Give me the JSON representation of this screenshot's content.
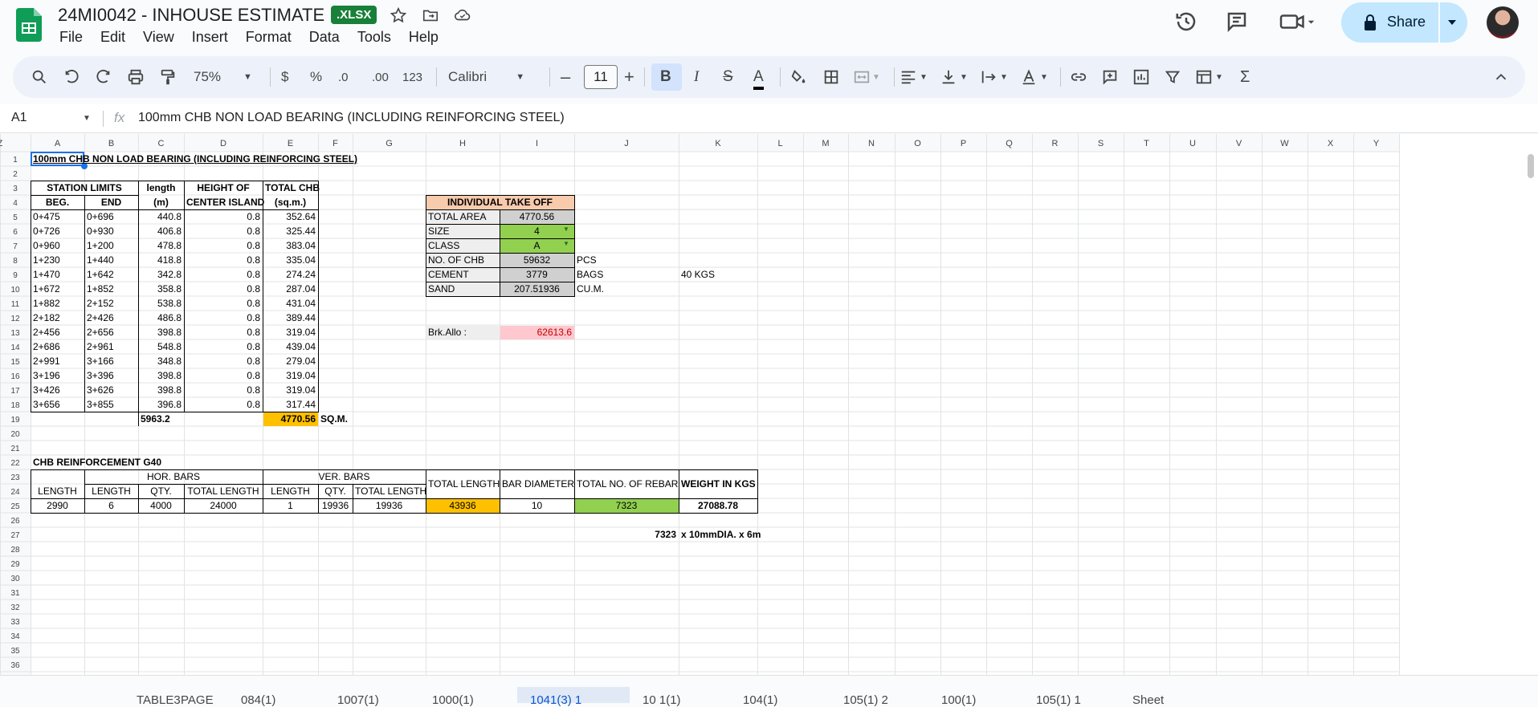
{
  "app": {
    "title": "24MI0042 - INHOUSE ESTIMATE",
    "badge": ".XLSX",
    "share_label": "Share",
    "menu": [
      "File",
      "Edit",
      "View",
      "Insert",
      "Format",
      "Data",
      "Tools",
      "Help"
    ]
  },
  "toolbar": {
    "zoom": "75%",
    "currency": "$",
    "percent": "%",
    "dec_decrease": ".0",
    "dec_increase": ".00",
    "number_format": "123",
    "font": "Calibri",
    "font_size": "11"
  },
  "formula_bar": {
    "name_box": "A1",
    "fx": "fx",
    "content": "100mm CHB NON LOAD BEARING (INCLUDING REINFORCING STEEL)"
  },
  "columns": [
    "A",
    "B",
    "C",
    "D",
    "E",
    "F",
    "G",
    "H",
    "I",
    "J",
    "K",
    "L",
    "M",
    "N",
    "O",
    "P",
    "Q",
    "R",
    "S",
    "T",
    "U",
    "V",
    "W",
    "X",
    "Y",
    "Z"
  ],
  "sheet": {
    "title": "100mm CHB NON LOAD BEARING (INCLUDING REINFORCING STEEL)",
    "table1_headers": {
      "station_limits": "STATION LIMITS",
      "beg": "BEG.",
      "end": "END",
      "length_1": "length",
      "length_2": "(m)",
      "height_1": "HEIGHT OF",
      "height_2": "CENTER ISLAND",
      "total_1": "TOTAL CHB",
      "total_2": "(sq.m.)"
    },
    "table1_rows": [
      [
        "0+475",
        "0+696",
        "440.8",
        "0.8",
        "352.64"
      ],
      [
        "0+726",
        "0+930",
        "406.8",
        "0.8",
        "325.44"
      ],
      [
        "0+960",
        "1+200",
        "478.8",
        "0.8",
        "383.04"
      ],
      [
        "1+230",
        "1+440",
        "418.8",
        "0.8",
        "335.04"
      ],
      [
        "1+470",
        "1+642",
        "342.8",
        "0.8",
        "274.24"
      ],
      [
        "1+672",
        "1+852",
        "358.8",
        "0.8",
        "287.04"
      ],
      [
        "1+882",
        "2+152",
        "538.8",
        "0.8",
        "431.04"
      ],
      [
        "2+182",
        "2+426",
        "486.8",
        "0.8",
        "389.44"
      ],
      [
        "2+456",
        "2+656",
        "398.8",
        "0.8",
        "319.04"
      ],
      [
        "2+686",
        "2+961",
        "548.8",
        "0.8",
        "439.04"
      ],
      [
        "2+991",
        "3+166",
        "348.8",
        "0.8",
        "279.04"
      ],
      [
        "3+196",
        "3+396",
        "398.8",
        "0.8",
        "319.04"
      ],
      [
        "3+426",
        "3+626",
        "398.8",
        "0.8",
        "319.04"
      ],
      [
        "3+656",
        "3+855",
        "396.8",
        "0.8",
        "317.44"
      ]
    ],
    "table1_total_length": "5963.2",
    "table1_total_chb": "4770.56",
    "table1_total_unit": "SQ.M.",
    "takeoff": {
      "title": "INDIVIDUAL TAKE OFF",
      "rows": [
        {
          "label": "TOTAL AREA",
          "value": "4770.56",
          "unit": "",
          "extra": ""
        },
        {
          "label": "SIZE",
          "value": "4",
          "unit": "",
          "extra": ""
        },
        {
          "label": "CLASS",
          "value": "A",
          "unit": "",
          "extra": ""
        },
        {
          "label": "NO. OF CHB",
          "value": "59632",
          "unit": "PCS",
          "extra": ""
        },
        {
          "label": "CEMENT",
          "value": "3779",
          "unit": "BAGS",
          "extra": "40 KGS"
        },
        {
          "label": "SAND",
          "value": "207.51936",
          "unit": "CU.M.",
          "extra": ""
        }
      ],
      "brk_label": "Brk.Allo :",
      "brk_value": "62613.6"
    },
    "reinforcement": {
      "title": "CHB REINFORCEMENT G40",
      "hor_bars": "HOR. BARS",
      "ver_bars": "VER. BARS",
      "headers": [
        "LENGTH",
        "LENGTH",
        "QTY.",
        "TOTAL LENGTH",
        "LENGTH",
        "QTY.",
        "TOTAL LENGTH",
        "TOTAL LENGTH",
        "BAR DIAMETER",
        "TOTAL NO. OF REBAR",
        "WEIGHT IN KGS"
      ],
      "values": [
        "2990",
        "6",
        "4000",
        "24000",
        "1",
        "19936",
        "19936",
        "43936",
        "10",
        "7323",
        "27088.78"
      ],
      "summary_count": "7323",
      "summary_text": "x 10mmDIA. x 6m"
    }
  },
  "sheet_tabs": [
    "TABLE3",
    "PAGE",
    "084(1)",
    "1007(1)",
    "1000(1)",
    "1041(3) 1",
    "10 1(1)",
    "104(1)",
    "105(1) 2",
    "100(1)",
    "105(1) 1",
    "Sheet"
  ],
  "colors": {
    "accent": "#0b57d0",
    "share_bg": "#c2e7ff",
    "badge_green": "#188038",
    "orange": "#ffc000",
    "green_cell": "#92d050",
    "peach": "#f8cbad",
    "pink": "#ffc7ce",
    "gray_cell": "#d0d0d0"
  }
}
